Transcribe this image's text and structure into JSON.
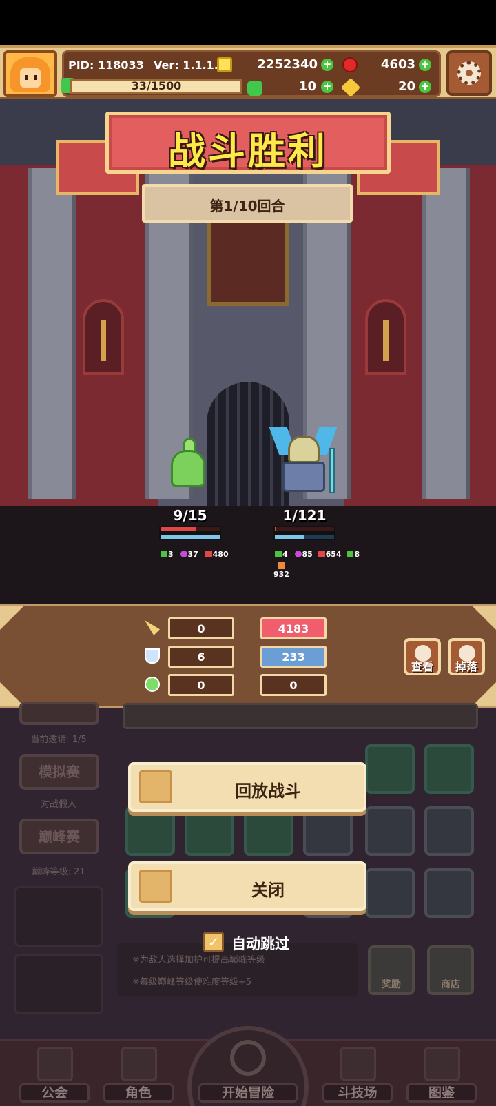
{
  "header": {
    "pid_label": "PID: 118033",
    "version_label": "Ver: 1.1.1.2",
    "gold": "2252340",
    "gems": "4603",
    "exp": "33/1500",
    "clover": "10",
    "keys": "20"
  },
  "battle": {
    "title": "战斗胜利",
    "round": "第1/10回合",
    "player": {
      "hp_text": "9/15",
      "hp_fraction": 0.6,
      "shield_fraction": 1.0,
      "stats": [
        "3",
        "37",
        "480"
      ]
    },
    "enemy": {
      "hp_text": "1/121",
      "hp_fraction": 0.01,
      "shield_fraction": 0.5,
      "stats": [
        "4",
        "85",
        "654",
        "8"
      ],
      "extra": "932"
    }
  },
  "result": {
    "rows": [
      {
        "icon": "sword-icon",
        "left": "0",
        "right": "4183",
        "right_style": "red"
      },
      {
        "icon": "shield-icon",
        "left": "6",
        "right": "233",
        "right_style": "blue"
      },
      {
        "icon": "heal-icon",
        "left": "0",
        "right": "0",
        "right_style": "plain"
      }
    ],
    "view_label": "查看",
    "drop_label": "掉落"
  },
  "underlay": {
    "invite_text": "当前邀请: 1/5",
    "sim_label": "模拟赛",
    "sim_sub": "对战假人",
    "peak_label": "巅峰赛",
    "peak_sub": "巅峰等级: 21",
    "tip1": "※为敌人选择加护可提高巅峰等级",
    "tip2": "※每级巅峰等级使难度等级+5",
    "reward_label": "奖励",
    "shop_label": "商店"
  },
  "dialog": {
    "replay_label": "回放战斗",
    "close_label": "关闭",
    "auto_skip_label": "自动跳过",
    "auto_skip_checked": true
  },
  "nav": {
    "guild": "公会",
    "character": "角色",
    "start": "开始冒险",
    "arena": "斗技场",
    "codex": "图鉴"
  },
  "colors": {
    "accent_red": "#e35f5f",
    "title_yellow": "#ffe949",
    "panel_brown": "#7a5034"
  }
}
